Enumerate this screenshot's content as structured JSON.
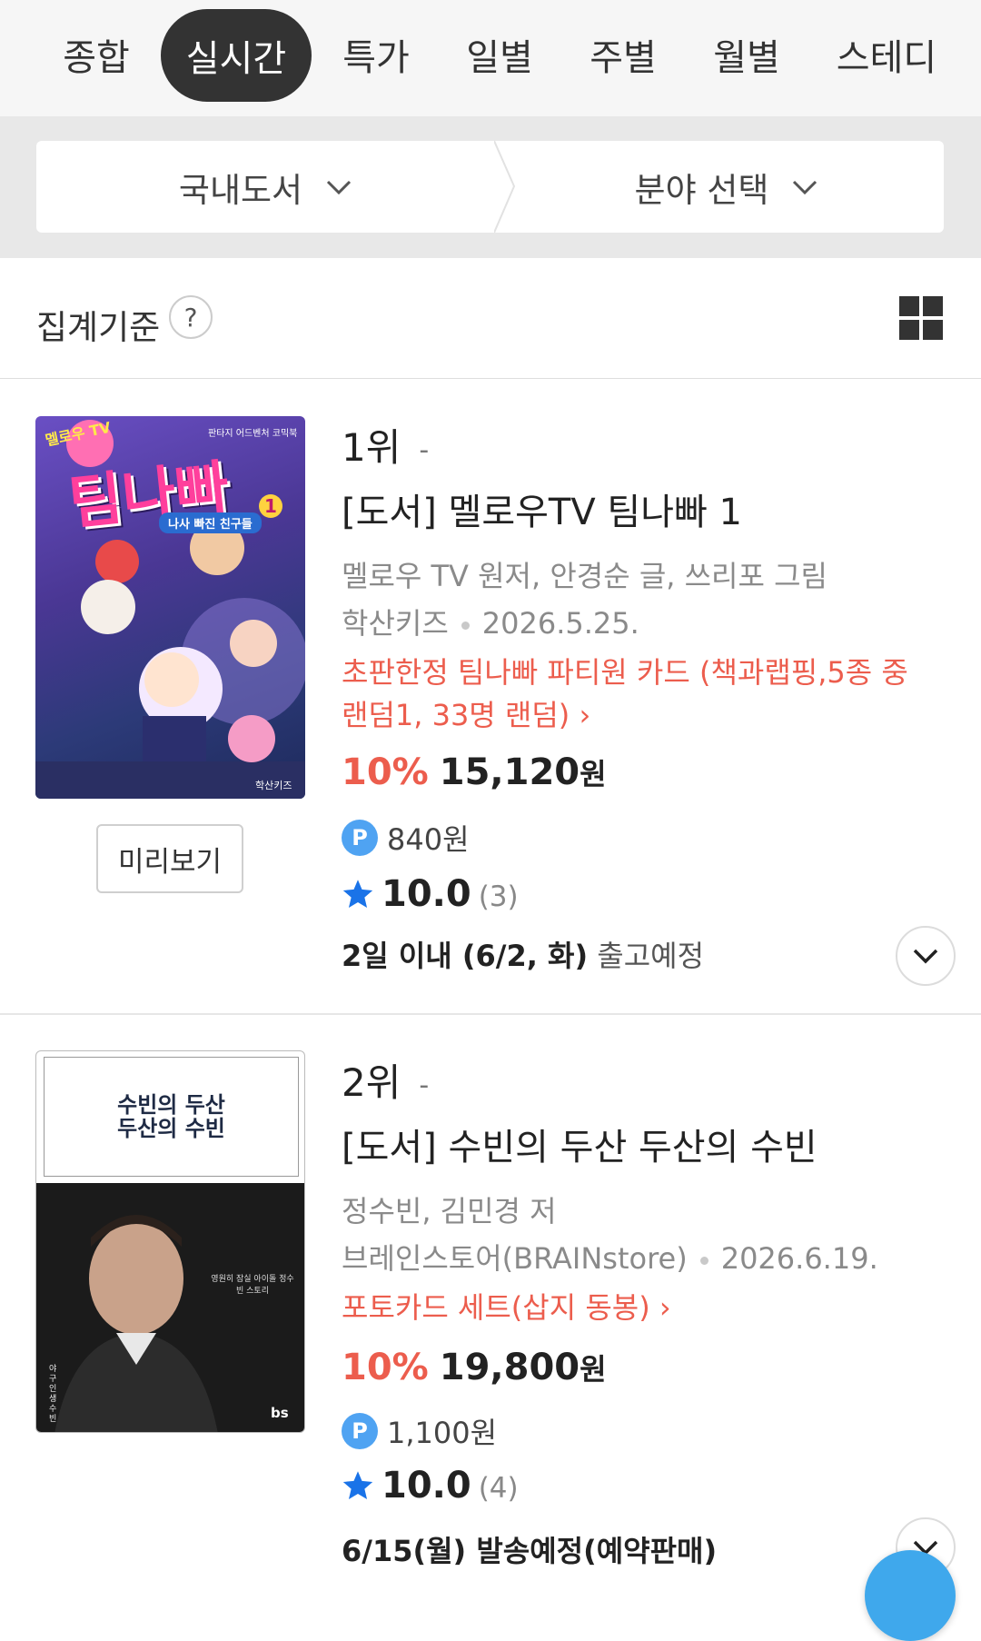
{
  "tabs": [
    "종합",
    "실시간",
    "특가",
    "일별",
    "주별",
    "월별",
    "스테디"
  ],
  "filters": {
    "category": "국내도서",
    "field": "분야 선택"
  },
  "criteria": {
    "label": "집계기준",
    "help": "?"
  },
  "books": [
    {
      "rank": "1위",
      "rank_change": "-",
      "title": "[도서] 멜로우TV 팀나빠 1",
      "authors": "멜로우 TV 원저, 안경순 글, 쓰리포 그림",
      "publisher": "학산키즈",
      "date": "2026.5.25.",
      "promo": "초판한정 팀나빠 파티원 카드 (책과랩핑,5종 중 랜덤1, 33명 랜덤) ›",
      "discount": "10%",
      "price": "15,120",
      "currency": "원",
      "points": "840원",
      "rating": "10.0",
      "reviews": "(3)",
      "shipping_bold": "2일 이내 (6/2, 화)",
      "shipping_rest": " 출고예정",
      "preview_label": "미리보기",
      "cover": {
        "badge": "멜로우 TV",
        "series": "판타지 어드벤처 코믹북",
        "big_title": "팀나빠",
        "subtitle": "나사 빠진 친구들",
        "volume": "1",
        "publisher": "학산키즈",
        "colors": [
          "#5a3ea8",
          "#e0399b",
          "#ffd23f"
        ]
      }
    },
    {
      "rank": "2위",
      "rank_change": "-",
      "title": "[도서] 수빈의 두산 두산의 수빈",
      "authors": "정수빈, 김민경 저",
      "publisher": "브레인스토어(BRAINstore)",
      "date": "2026.6.19.",
      "promo": "포토카드 세트(삽지 동봉) ›",
      "discount": "10%",
      "price": "19,800",
      "currency": "원",
      "points": "1,100원",
      "rating": "10.0",
      "reviews": "(4)",
      "shipping_bold": "6/15(월) 발송예정(예약판매)",
      "shipping_rest": "",
      "cover": {
        "title_line1": "수빈의 두산",
        "title_line2": "두산의 수빈",
        "tagline": "영원히 잠실 아이돌 정수빈 스토리",
        "side": "야구 인생 수빈",
        "logo": "bs"
      }
    }
  ],
  "colors": {
    "accent_red": "#ec5d4d",
    "point_blue": "#4fa3f2",
    "star_blue": "#1a73e8",
    "tab_active": "#333333"
  },
  "icons": [
    "grid-view-icon",
    "chevron-down-icon",
    "star-icon",
    "point-icon",
    "help-icon"
  ]
}
